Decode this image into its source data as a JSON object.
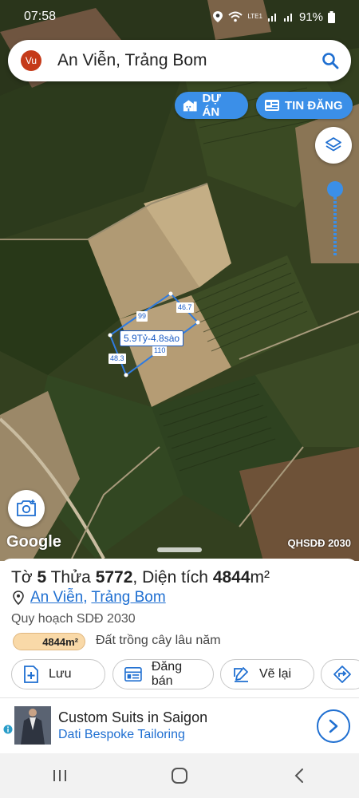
{
  "status": {
    "time": "07:58",
    "battery": "91%",
    "lte_label": "LTE1"
  },
  "search": {
    "avatar_initials": "Vu",
    "title": "An Viễn, Trảng Bom"
  },
  "map_buttons": {
    "du_an": "DỰ ÁN",
    "tin_dang": "TIN ĐĂNG"
  },
  "plot": {
    "price_label": "5.9Tỷ-4.8sào",
    "edges": {
      "top": "99",
      "right": "46.7",
      "bottom": "110",
      "left": "48.3"
    }
  },
  "map_footer": {
    "logo": "Google",
    "plan_tag": "QHSDĐ 2030"
  },
  "parcel": {
    "to_label": "Tờ",
    "to_value": "5",
    "thua_label": "Thửa",
    "thua_value": "5772",
    "area_label": ", Diện tích",
    "area_value": "4844",
    "area_unit": "m²",
    "ward": "An Viễn",
    "district": "Trảng Bom",
    "zone": "Quy hoạch SDĐ 2030",
    "area_badge": "4844m²",
    "land_use": "Đất trồng cây lâu năm"
  },
  "actions": {
    "save": "Lưu",
    "sell": "Đăng bán",
    "redraw": "Vẽ lại"
  },
  "ad": {
    "title": "Custom Suits in Saigon",
    "subtitle": "Dati Bespoke Tailoring"
  },
  "colors": {
    "accent": "#3b8fe8",
    "link": "#1f6fd1",
    "plot_outline": "#2f7be0",
    "badge": "#f9d9a8"
  }
}
